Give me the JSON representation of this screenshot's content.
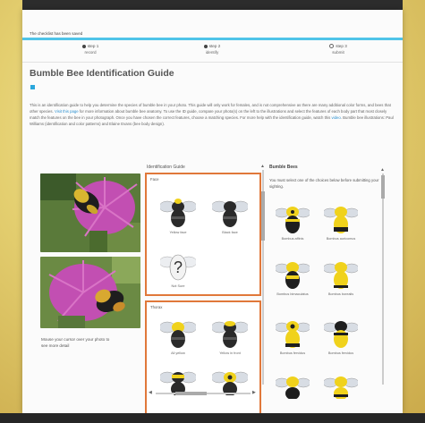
{
  "notice": "The checklist has been saved",
  "steps": [
    {
      "num": "step 1",
      "label": "record",
      "state": "done"
    },
    {
      "num": "step 2",
      "label": "identify",
      "state": "current"
    },
    {
      "num": "step 3",
      "label": "submit",
      "state": "todo"
    }
  ],
  "title": "Bumble Bee Identification Guide",
  "intro": {
    "p1": "This is an identification guide to help you determine the species of bumble bee in your photo. This guide will only work for females, and is not comprehensive as there are many additional color forms, and bees that other species.",
    "link1": "Visit this page",
    "p2": "for more information about bumble bee anatomy. To use the ID guide, compare your photo(s) on the left to the illustrations and select the features of each body part that most closely match the features on the bee in your photograph. Once you have chosen the correct features, choose a matching species. For more help with the identification guide, watch this",
    "link2": "video",
    "p3": ". Bumble bee illustrations: Paul Williams (identification and color patterns) and Elaine Evans (bee body design)."
  },
  "photo_caption": "Mouse your cursor over your photo to see more detail",
  "guide": {
    "title": "Identification Guide",
    "group1": {
      "label": "Face",
      "items": [
        "Yellow face",
        "Black face",
        "Not Sure"
      ]
    },
    "group2": {
      "label": "Thorax",
      "items": [
        "All yellow",
        "Yellow in front",
        "",
        ""
      ]
    }
  },
  "bees": {
    "title": "Bumble Bees",
    "instruction": "You must select one of the choices below before submitting your sighting.",
    "items": [
      "Bombus affinis",
      "Bombus auricomus",
      "Bombus bimaculatus",
      "Bombus borealis",
      "Bombus fervidus",
      "Bombus fervidus",
      "",
      ""
    ]
  },
  "colors": {
    "accent": "#4fc4e8",
    "highlight": "#e0783a",
    "bee_yellow": "#f0d21c",
    "bee_black": "#1e1e1e"
  }
}
